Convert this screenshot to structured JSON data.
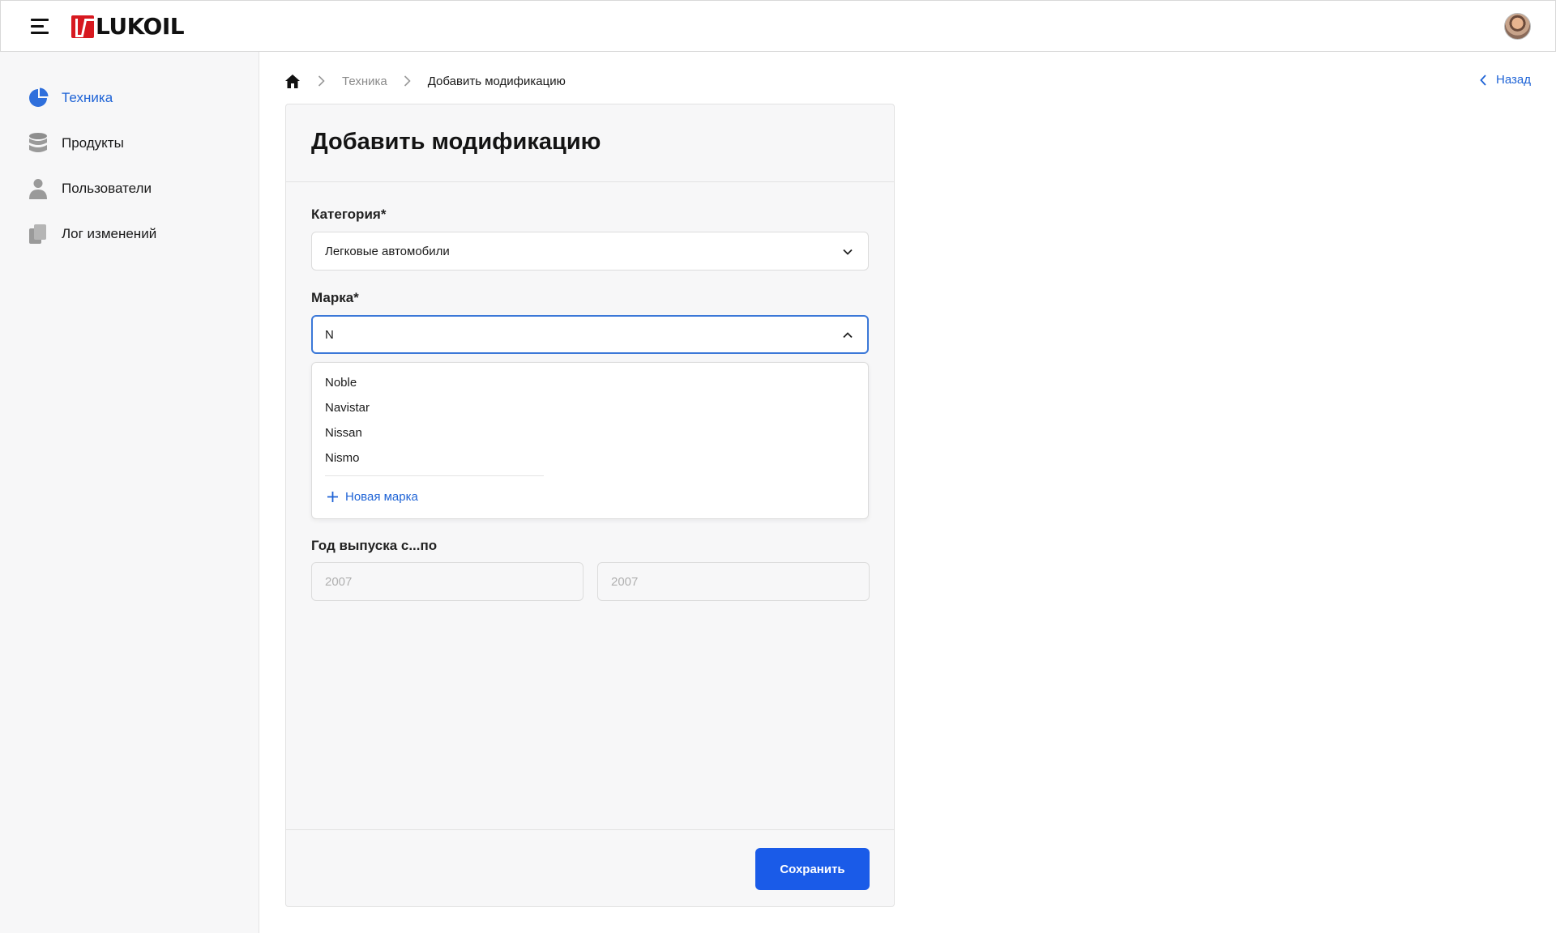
{
  "header": {
    "logo_text": "LUKOIL",
    "menu_icon": "hamburger-icon",
    "avatar": "user-avatar"
  },
  "sidebar": {
    "items": [
      {
        "label": "Техника",
        "icon": "pie-chart-icon",
        "active": true
      },
      {
        "label": "Продукты",
        "icon": "database-icon",
        "active": false
      },
      {
        "label": "Пользователи",
        "icon": "user-icon",
        "active": false
      },
      {
        "label": "Лог изменений",
        "icon": "documents-icon",
        "active": false
      }
    ]
  },
  "breadcrumb": {
    "home_icon": "home-icon",
    "items": [
      "Техника",
      "Добавить модификацию"
    ]
  },
  "back_link": {
    "label": "Назад",
    "icon": "chevron-left-icon"
  },
  "form": {
    "title": "Добавить модификацию",
    "category": {
      "label": "Категория*",
      "value": "Легковые автомобили"
    },
    "brand": {
      "label": "Марка*",
      "value": "N",
      "options": [
        "Noble",
        "Navistar",
        "Nissan",
        "Nismo"
      ],
      "new_label": "Новая марка"
    },
    "years": {
      "label": "Год выпуска с...по",
      "from_placeholder": "2007",
      "to_placeholder": "2007"
    },
    "save_label": "Сохранить"
  },
  "colors": {
    "accent": "#1e63d6",
    "primary_button": "#1a5be8",
    "brand_red": "#d71920",
    "sidebar_bg": "#f7f7f8"
  }
}
